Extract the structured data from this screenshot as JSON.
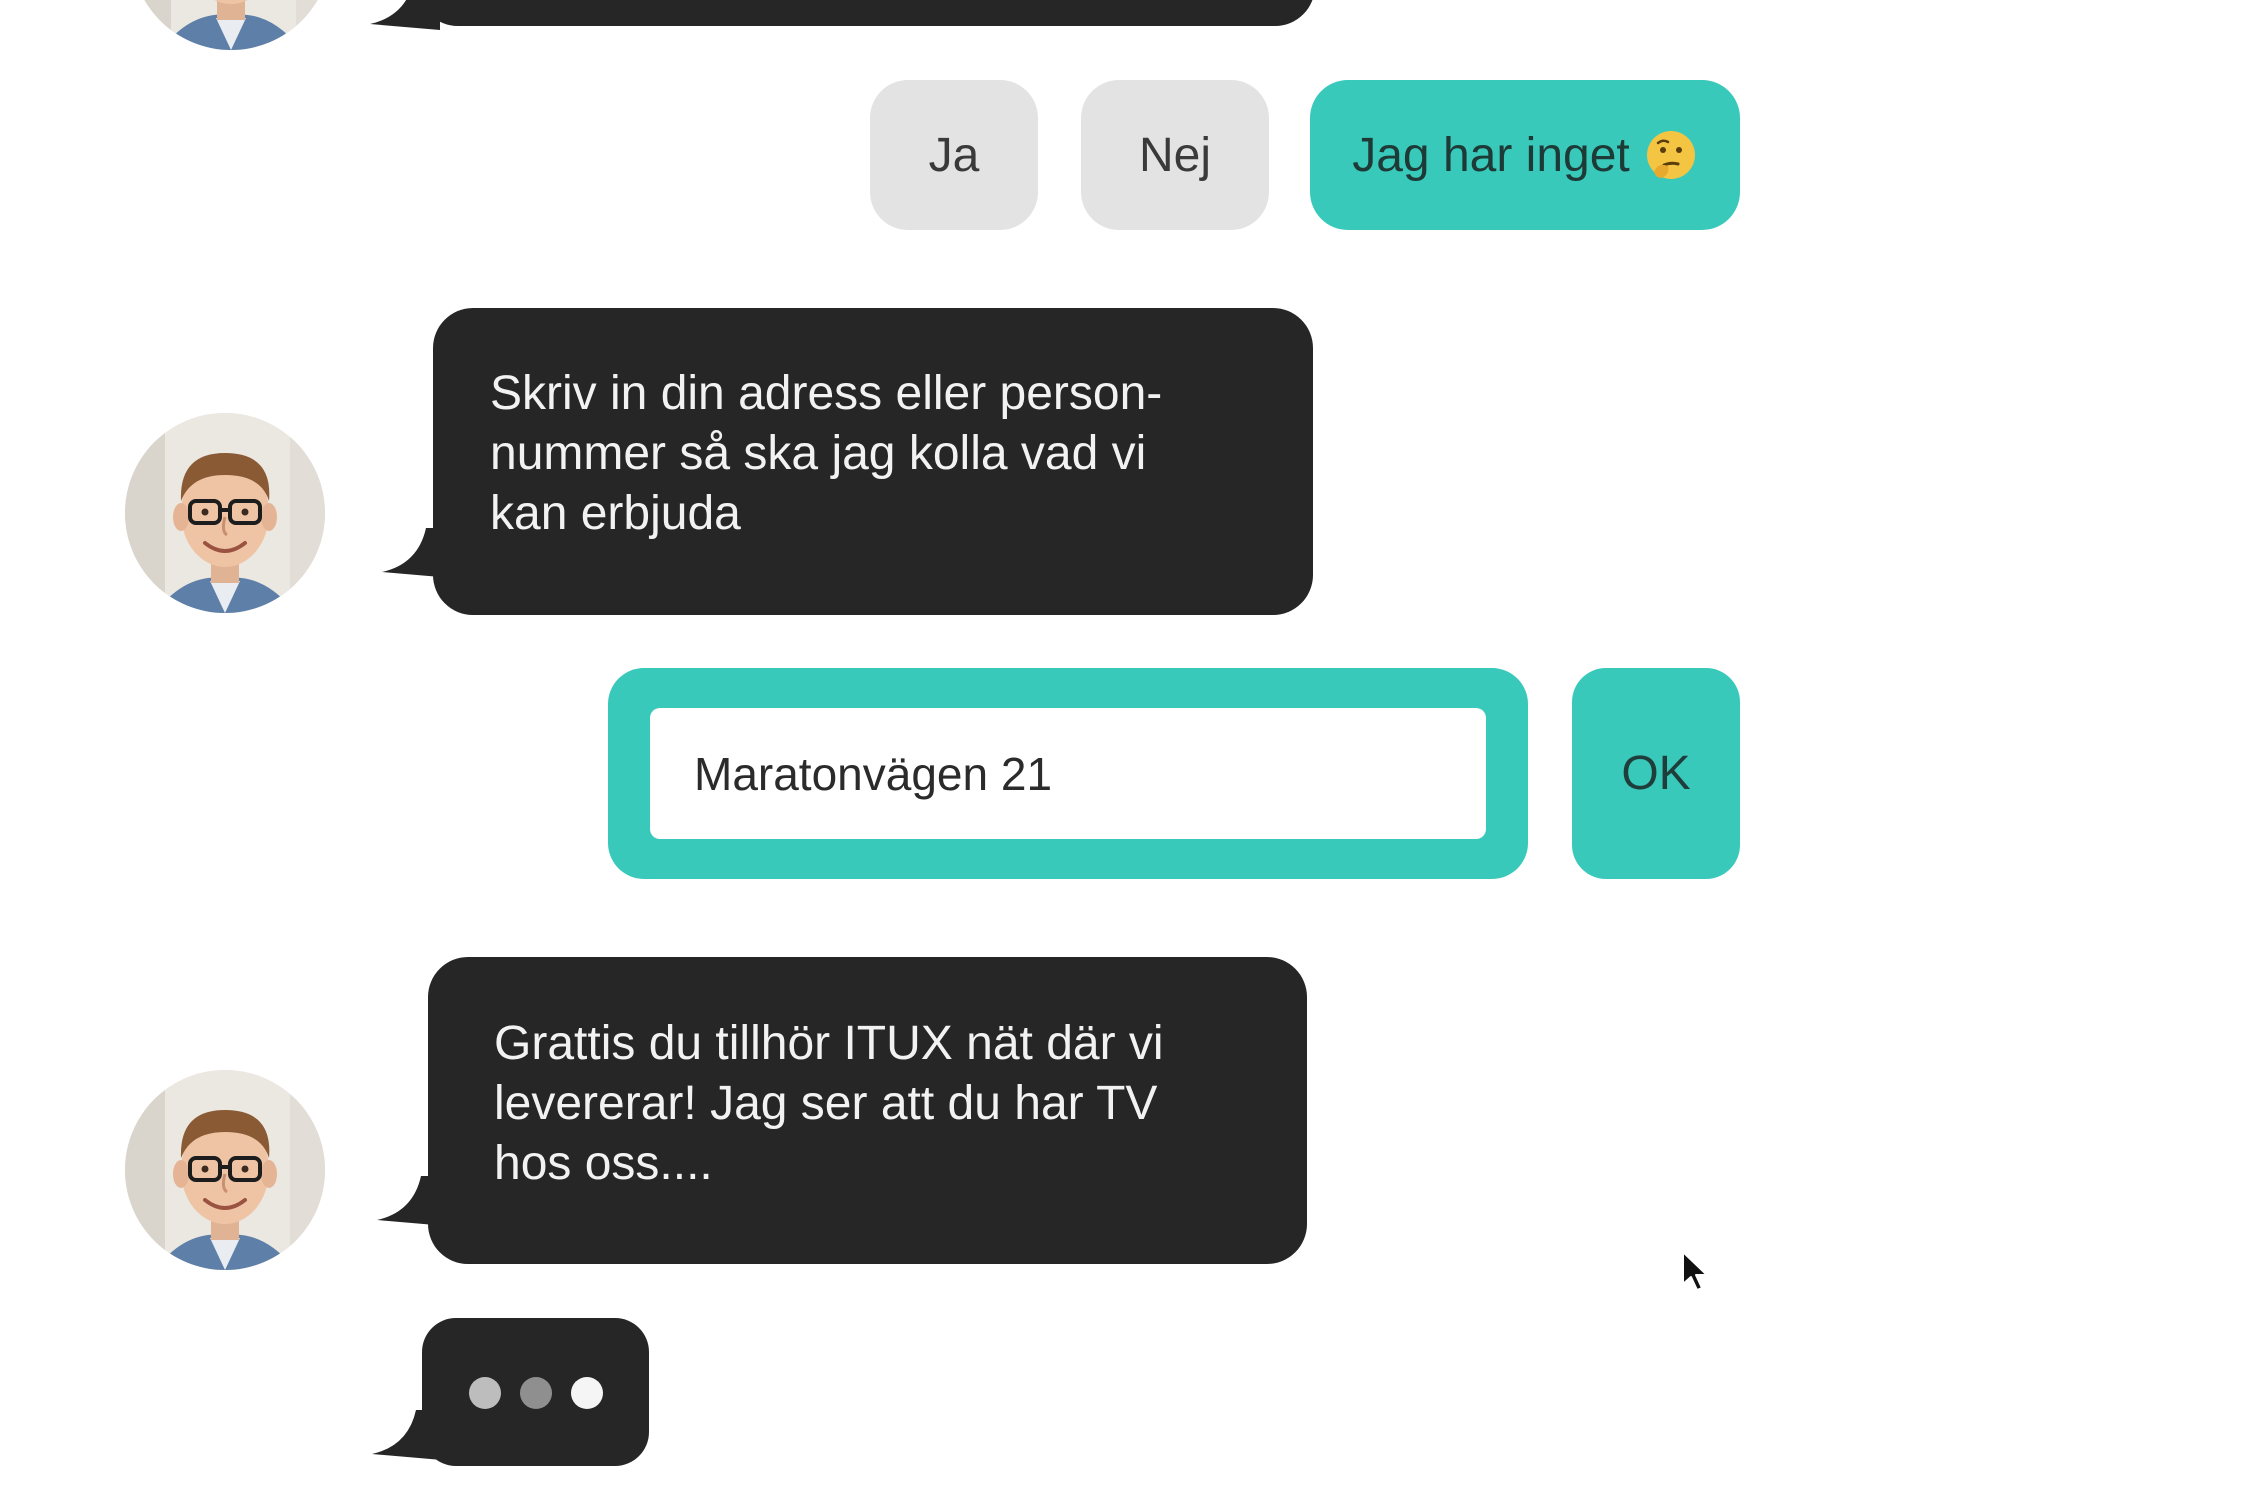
{
  "chat": {
    "messages": [
      {
        "sender": "bot",
        "text": "Skriv in din adress eller person-\nnummer så ska jag kolla vad vi\nkan erbjuda"
      },
      {
        "sender": "bot",
        "text": "Grattis du tillhör ITUX nät där vi\nlevererar! Jag ser att du har TV\nhos oss...."
      }
    ],
    "quick_replies": {
      "yes_label": "Ja",
      "no_label": "Nej",
      "none_label": "Jag har inget"
    },
    "address_input": {
      "value": "Maratonvägen 21"
    },
    "ok_label": "OK",
    "typing_indicator": "typing-dots",
    "avatar": "bot-agent-avatar"
  },
  "icons": {
    "emoji": "thinking-face-icon",
    "cursor": "mouse-pointer-icon"
  },
  "colors": {
    "bubble_bg": "#262626",
    "bubble_text": "#f2f2f2",
    "accent_teal": "#39c9bb",
    "button_grey": "#e3e3e3",
    "background": "#ffffff"
  }
}
